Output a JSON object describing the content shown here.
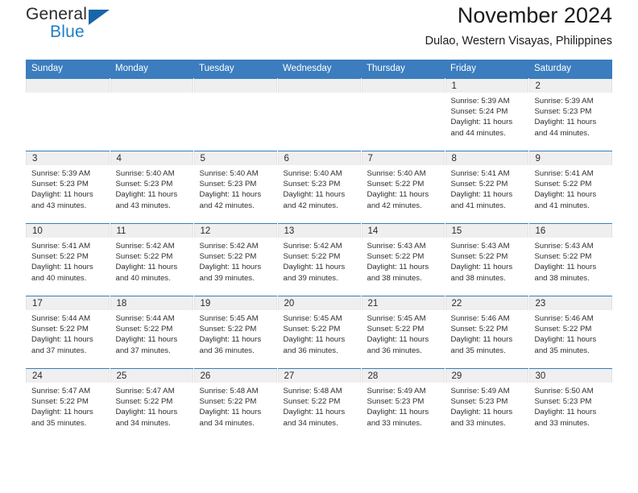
{
  "brand": {
    "name_top": "General",
    "name_bottom": "Blue",
    "triangle_color": "#1766a8",
    "accent_color": "#1f7fc4"
  },
  "header": {
    "title": "November 2024",
    "subtitle": "Dulao, Western Visayas, Philippines"
  },
  "theme": {
    "header_row_color": "#3b7dbf",
    "daynum_band_color": "#efefef",
    "text_color": "#2e2e2e"
  },
  "weekdays": [
    "Sunday",
    "Monday",
    "Tuesday",
    "Wednesday",
    "Thursday",
    "Friday",
    "Saturday"
  ],
  "labels": {
    "sunrise_prefix": "Sunrise: ",
    "sunset_prefix": "Sunset: ",
    "daylight_prefix": "Daylight: "
  },
  "weeks": [
    [
      {
        "day": ""
      },
      {
        "day": ""
      },
      {
        "day": ""
      },
      {
        "day": ""
      },
      {
        "day": ""
      },
      {
        "day": "1",
        "sunrise": "Sunrise: 5:39 AM",
        "sunset": "Sunset: 5:24 PM",
        "daylight_line1": "Daylight: 11 hours",
        "daylight_line2": "and 44 minutes."
      },
      {
        "day": "2",
        "sunrise": "Sunrise: 5:39 AM",
        "sunset": "Sunset: 5:23 PM",
        "daylight_line1": "Daylight: 11 hours",
        "daylight_line2": "and 44 minutes."
      }
    ],
    [
      {
        "day": "3",
        "sunrise": "Sunrise: 5:39 AM",
        "sunset": "Sunset: 5:23 PM",
        "daylight_line1": "Daylight: 11 hours",
        "daylight_line2": "and 43 minutes."
      },
      {
        "day": "4",
        "sunrise": "Sunrise: 5:40 AM",
        "sunset": "Sunset: 5:23 PM",
        "daylight_line1": "Daylight: 11 hours",
        "daylight_line2": "and 43 minutes."
      },
      {
        "day": "5",
        "sunrise": "Sunrise: 5:40 AM",
        "sunset": "Sunset: 5:23 PM",
        "daylight_line1": "Daylight: 11 hours",
        "daylight_line2": "and 42 minutes."
      },
      {
        "day": "6",
        "sunrise": "Sunrise: 5:40 AM",
        "sunset": "Sunset: 5:23 PM",
        "daylight_line1": "Daylight: 11 hours",
        "daylight_line2": "and 42 minutes."
      },
      {
        "day": "7",
        "sunrise": "Sunrise: 5:40 AM",
        "sunset": "Sunset: 5:22 PM",
        "daylight_line1": "Daylight: 11 hours",
        "daylight_line2": "and 42 minutes."
      },
      {
        "day": "8",
        "sunrise": "Sunrise: 5:41 AM",
        "sunset": "Sunset: 5:22 PM",
        "daylight_line1": "Daylight: 11 hours",
        "daylight_line2": "and 41 minutes."
      },
      {
        "day": "9",
        "sunrise": "Sunrise: 5:41 AM",
        "sunset": "Sunset: 5:22 PM",
        "daylight_line1": "Daylight: 11 hours",
        "daylight_line2": "and 41 minutes."
      }
    ],
    [
      {
        "day": "10",
        "sunrise": "Sunrise: 5:41 AM",
        "sunset": "Sunset: 5:22 PM",
        "daylight_line1": "Daylight: 11 hours",
        "daylight_line2": "and 40 minutes."
      },
      {
        "day": "11",
        "sunrise": "Sunrise: 5:42 AM",
        "sunset": "Sunset: 5:22 PM",
        "daylight_line1": "Daylight: 11 hours",
        "daylight_line2": "and 40 minutes."
      },
      {
        "day": "12",
        "sunrise": "Sunrise: 5:42 AM",
        "sunset": "Sunset: 5:22 PM",
        "daylight_line1": "Daylight: 11 hours",
        "daylight_line2": "and 39 minutes."
      },
      {
        "day": "13",
        "sunrise": "Sunrise: 5:42 AM",
        "sunset": "Sunset: 5:22 PM",
        "daylight_line1": "Daylight: 11 hours",
        "daylight_line2": "and 39 minutes."
      },
      {
        "day": "14",
        "sunrise": "Sunrise: 5:43 AM",
        "sunset": "Sunset: 5:22 PM",
        "daylight_line1": "Daylight: 11 hours",
        "daylight_line2": "and 38 minutes."
      },
      {
        "day": "15",
        "sunrise": "Sunrise: 5:43 AM",
        "sunset": "Sunset: 5:22 PM",
        "daylight_line1": "Daylight: 11 hours",
        "daylight_line2": "and 38 minutes."
      },
      {
        "day": "16",
        "sunrise": "Sunrise: 5:43 AM",
        "sunset": "Sunset: 5:22 PM",
        "daylight_line1": "Daylight: 11 hours",
        "daylight_line2": "and 38 minutes."
      }
    ],
    [
      {
        "day": "17",
        "sunrise": "Sunrise: 5:44 AM",
        "sunset": "Sunset: 5:22 PM",
        "daylight_line1": "Daylight: 11 hours",
        "daylight_line2": "and 37 minutes."
      },
      {
        "day": "18",
        "sunrise": "Sunrise: 5:44 AM",
        "sunset": "Sunset: 5:22 PM",
        "daylight_line1": "Daylight: 11 hours",
        "daylight_line2": "and 37 minutes."
      },
      {
        "day": "19",
        "sunrise": "Sunrise: 5:45 AM",
        "sunset": "Sunset: 5:22 PM",
        "daylight_line1": "Daylight: 11 hours",
        "daylight_line2": "and 36 minutes."
      },
      {
        "day": "20",
        "sunrise": "Sunrise: 5:45 AM",
        "sunset": "Sunset: 5:22 PM",
        "daylight_line1": "Daylight: 11 hours",
        "daylight_line2": "and 36 minutes."
      },
      {
        "day": "21",
        "sunrise": "Sunrise: 5:45 AM",
        "sunset": "Sunset: 5:22 PM",
        "daylight_line1": "Daylight: 11 hours",
        "daylight_line2": "and 36 minutes."
      },
      {
        "day": "22",
        "sunrise": "Sunrise: 5:46 AM",
        "sunset": "Sunset: 5:22 PM",
        "daylight_line1": "Daylight: 11 hours",
        "daylight_line2": "and 35 minutes."
      },
      {
        "day": "23",
        "sunrise": "Sunrise: 5:46 AM",
        "sunset": "Sunset: 5:22 PM",
        "daylight_line1": "Daylight: 11 hours",
        "daylight_line2": "and 35 minutes."
      }
    ],
    [
      {
        "day": "24",
        "sunrise": "Sunrise: 5:47 AM",
        "sunset": "Sunset: 5:22 PM",
        "daylight_line1": "Daylight: 11 hours",
        "daylight_line2": "and 35 minutes."
      },
      {
        "day": "25",
        "sunrise": "Sunrise: 5:47 AM",
        "sunset": "Sunset: 5:22 PM",
        "daylight_line1": "Daylight: 11 hours",
        "daylight_line2": "and 34 minutes."
      },
      {
        "day": "26",
        "sunrise": "Sunrise: 5:48 AM",
        "sunset": "Sunset: 5:22 PM",
        "daylight_line1": "Daylight: 11 hours",
        "daylight_line2": "and 34 minutes."
      },
      {
        "day": "27",
        "sunrise": "Sunrise: 5:48 AM",
        "sunset": "Sunset: 5:22 PM",
        "daylight_line1": "Daylight: 11 hours",
        "daylight_line2": "and 34 minutes."
      },
      {
        "day": "28",
        "sunrise": "Sunrise: 5:49 AM",
        "sunset": "Sunset: 5:23 PM",
        "daylight_line1": "Daylight: 11 hours",
        "daylight_line2": "and 33 minutes."
      },
      {
        "day": "29",
        "sunrise": "Sunrise: 5:49 AM",
        "sunset": "Sunset: 5:23 PM",
        "daylight_line1": "Daylight: 11 hours",
        "daylight_line2": "and 33 minutes."
      },
      {
        "day": "30",
        "sunrise": "Sunrise: 5:50 AM",
        "sunset": "Sunset: 5:23 PM",
        "daylight_line1": "Daylight: 11 hours",
        "daylight_line2": "and 33 minutes."
      }
    ]
  ]
}
